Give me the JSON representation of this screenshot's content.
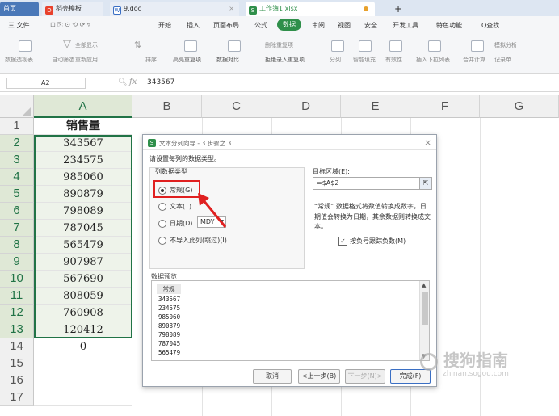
{
  "tabs": [
    {
      "label": "首页",
      "icon": "home-icon"
    },
    {
      "label": "稻壳模板",
      "icon": "docer-icon"
    },
    {
      "label": "9.doc",
      "icon": "word-doc-icon"
    },
    {
      "label": "工作簿1.xlsx",
      "icon": "excel-file-icon"
    }
  ],
  "new_tab_label": "+",
  "menu": {
    "file": "三 文件",
    "items": [
      "开始",
      "插入",
      "页面布局",
      "公式",
      "数据",
      "审阅",
      "视图",
      "安全",
      "开发工具",
      "特色功能"
    ],
    "active": "数据",
    "search": "Q查找"
  },
  "ribbon": {
    "items": [
      "数据透视表",
      "自动筛选",
      "全部显示",
      "重新应用",
      "排序",
      "高亮重复项",
      "数据对比",
      "删除重复项",
      "拒绝录入重复项",
      "分列",
      "智能填充",
      "有效性",
      "插入下拉列表",
      "合并计算",
      "模拟分析",
      "记录单"
    ]
  },
  "formula_bar": {
    "cell_ref": "A2",
    "fx": "fx",
    "value": "343567"
  },
  "grid": {
    "columns": [
      "A",
      "B",
      "C",
      "D",
      "E",
      "F",
      "G"
    ],
    "rows": [
      "1",
      "2",
      "3",
      "4",
      "5",
      "6",
      "7",
      "8",
      "9",
      "10",
      "11",
      "12",
      "13",
      "14",
      "15",
      "16",
      "17"
    ],
    "colA": [
      "销售量",
      "343567",
      "234575",
      "985060",
      "890879",
      "798089",
      "787045",
      "565479",
      "907987",
      "567690",
      "808059",
      "760908",
      "120412",
      "0",
      "",
      "",
      ""
    ]
  },
  "dialog": {
    "title": "文本分列向导 - 3 步骤之 3",
    "close": "×",
    "prompt": "请设置每列的数据类型。",
    "group_label": "列数据类型",
    "options": [
      "常规(G)",
      "文本(T)",
      "日期(D)",
      "不导入此列(跳过)(I)"
    ],
    "selected_option": "常规(G)",
    "date_format": "MDY",
    "target_label": "目标区域(E):",
    "target_value": "=$A$2",
    "description": [
      "“常规” 数据格式将数值转换成数字，日",
      "期值会转换为日期，其余数据则转换成文",
      "本。"
    ],
    "negative_checkbox": "按负号跟踪负数(M)",
    "negative_checked": true,
    "preview_label": "数据预览",
    "preview_header": "常规",
    "preview_values": [
      "343567",
      "234575",
      "985060",
      "890879",
      "798089",
      "787045",
      "565479"
    ],
    "buttons": {
      "cancel": "取消",
      "back": "<上一步(B)",
      "next": "下一步(N)>",
      "finish": "完成(F)"
    }
  },
  "watermark": {
    "text": "搜狗指南",
    "url": "zhinan.sogou.com"
  },
  "colors": {
    "accent_green": "#217346",
    "highlight_red": "#e02020",
    "data_tab_green": "#2f8f4a"
  }
}
